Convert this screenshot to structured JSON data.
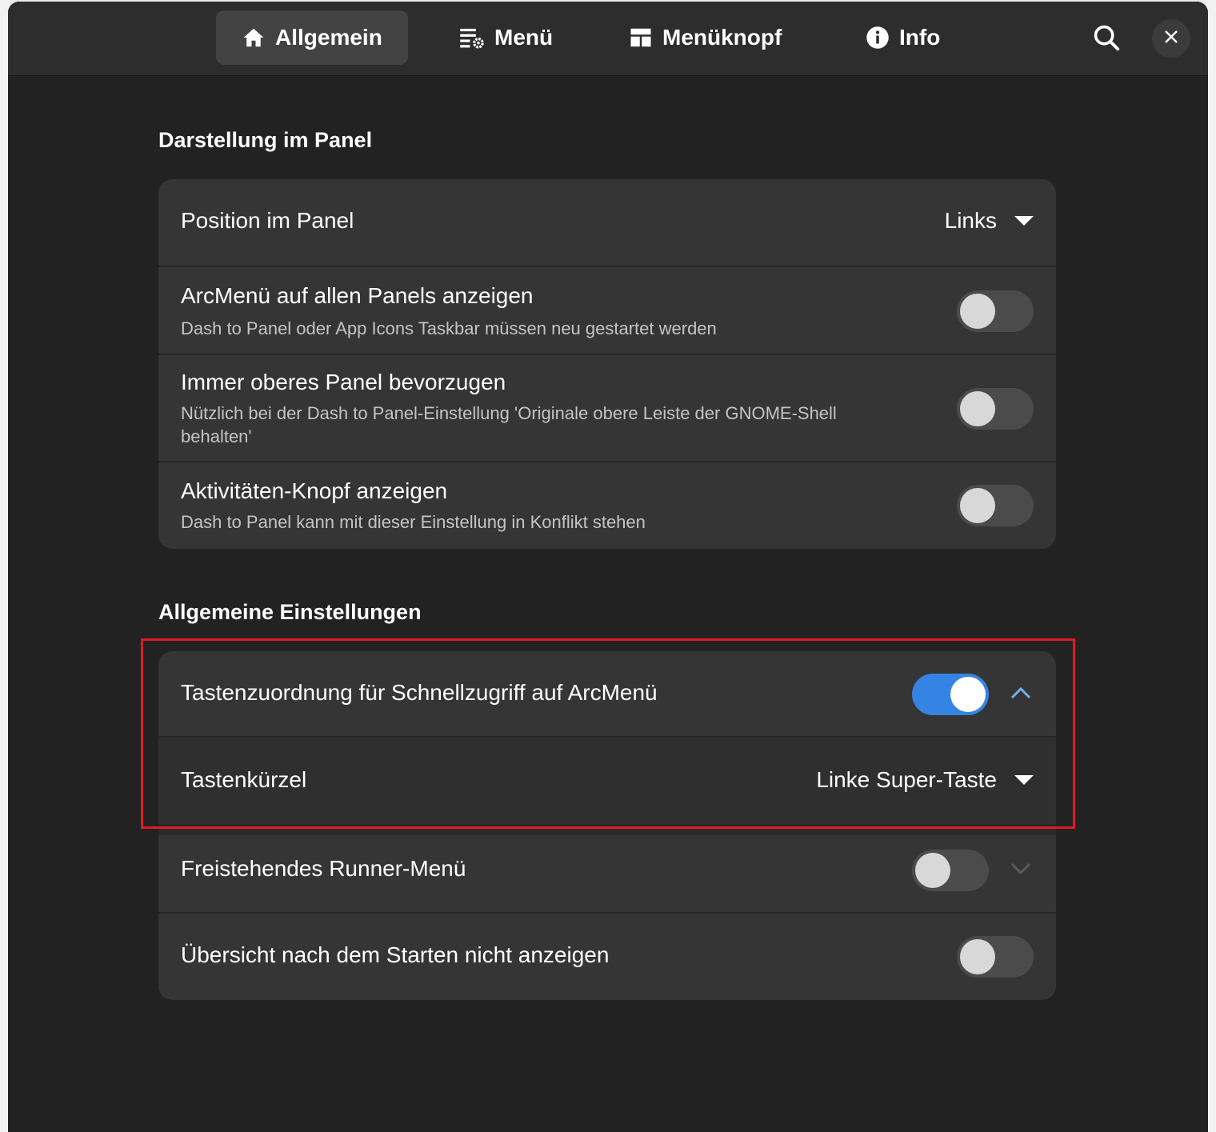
{
  "tabs": [
    {
      "label": "Allgemein",
      "icon": "home-icon",
      "active": true
    },
    {
      "label": "Menü",
      "icon": "menu-settings-icon",
      "active": false
    },
    {
      "label": "Menüknopf",
      "icon": "layout-icon",
      "active": false
    },
    {
      "label": "Info",
      "icon": "info-icon",
      "active": false
    }
  ],
  "header": {
    "search_icon": "search-icon",
    "close_icon": "close-icon"
  },
  "section_panel": {
    "title": "Darstellung im Panel",
    "position": {
      "title": "Position im Panel",
      "value": "Links"
    },
    "all_panels": {
      "title": "ArcMenü auf allen Panels anzeigen",
      "subtitle": "Dash to Panel oder App Icons Taskbar müssen neu gestartet werden",
      "enabled": false
    },
    "prefer_top": {
      "title": "Immer oberes Panel bevorzugen",
      "subtitle": "Nützlich bei der Dash to Panel-Einstellung 'Originale obere Leiste der GNOME-Shell behalten'",
      "enabled": false
    },
    "activities": {
      "title": "Aktivitäten-Knopf anzeigen",
      "subtitle": "Dash to Panel kann mit dieser Einstellung in Konflikt stehen",
      "enabled": false
    }
  },
  "section_general": {
    "title": "Allgemeine Einstellungen",
    "hotkey": {
      "title": "Tastenzuordnung für Schnellzugriff auf ArcMenü",
      "enabled": true,
      "expanded": true
    },
    "shortcut": {
      "title": "Tastenkürzel",
      "value": "Linke Super-Taste"
    },
    "runner": {
      "title": "Freistehendes Runner-Menü",
      "enabled": false,
      "expanded": false
    },
    "overview": {
      "title": "Übersicht nach dem Starten nicht anzeigen",
      "enabled": false
    }
  },
  "colors": {
    "accent": "#3584e4",
    "highlight": "#e01b24",
    "window_bg": "#222222",
    "card_bg": "#353535"
  }
}
